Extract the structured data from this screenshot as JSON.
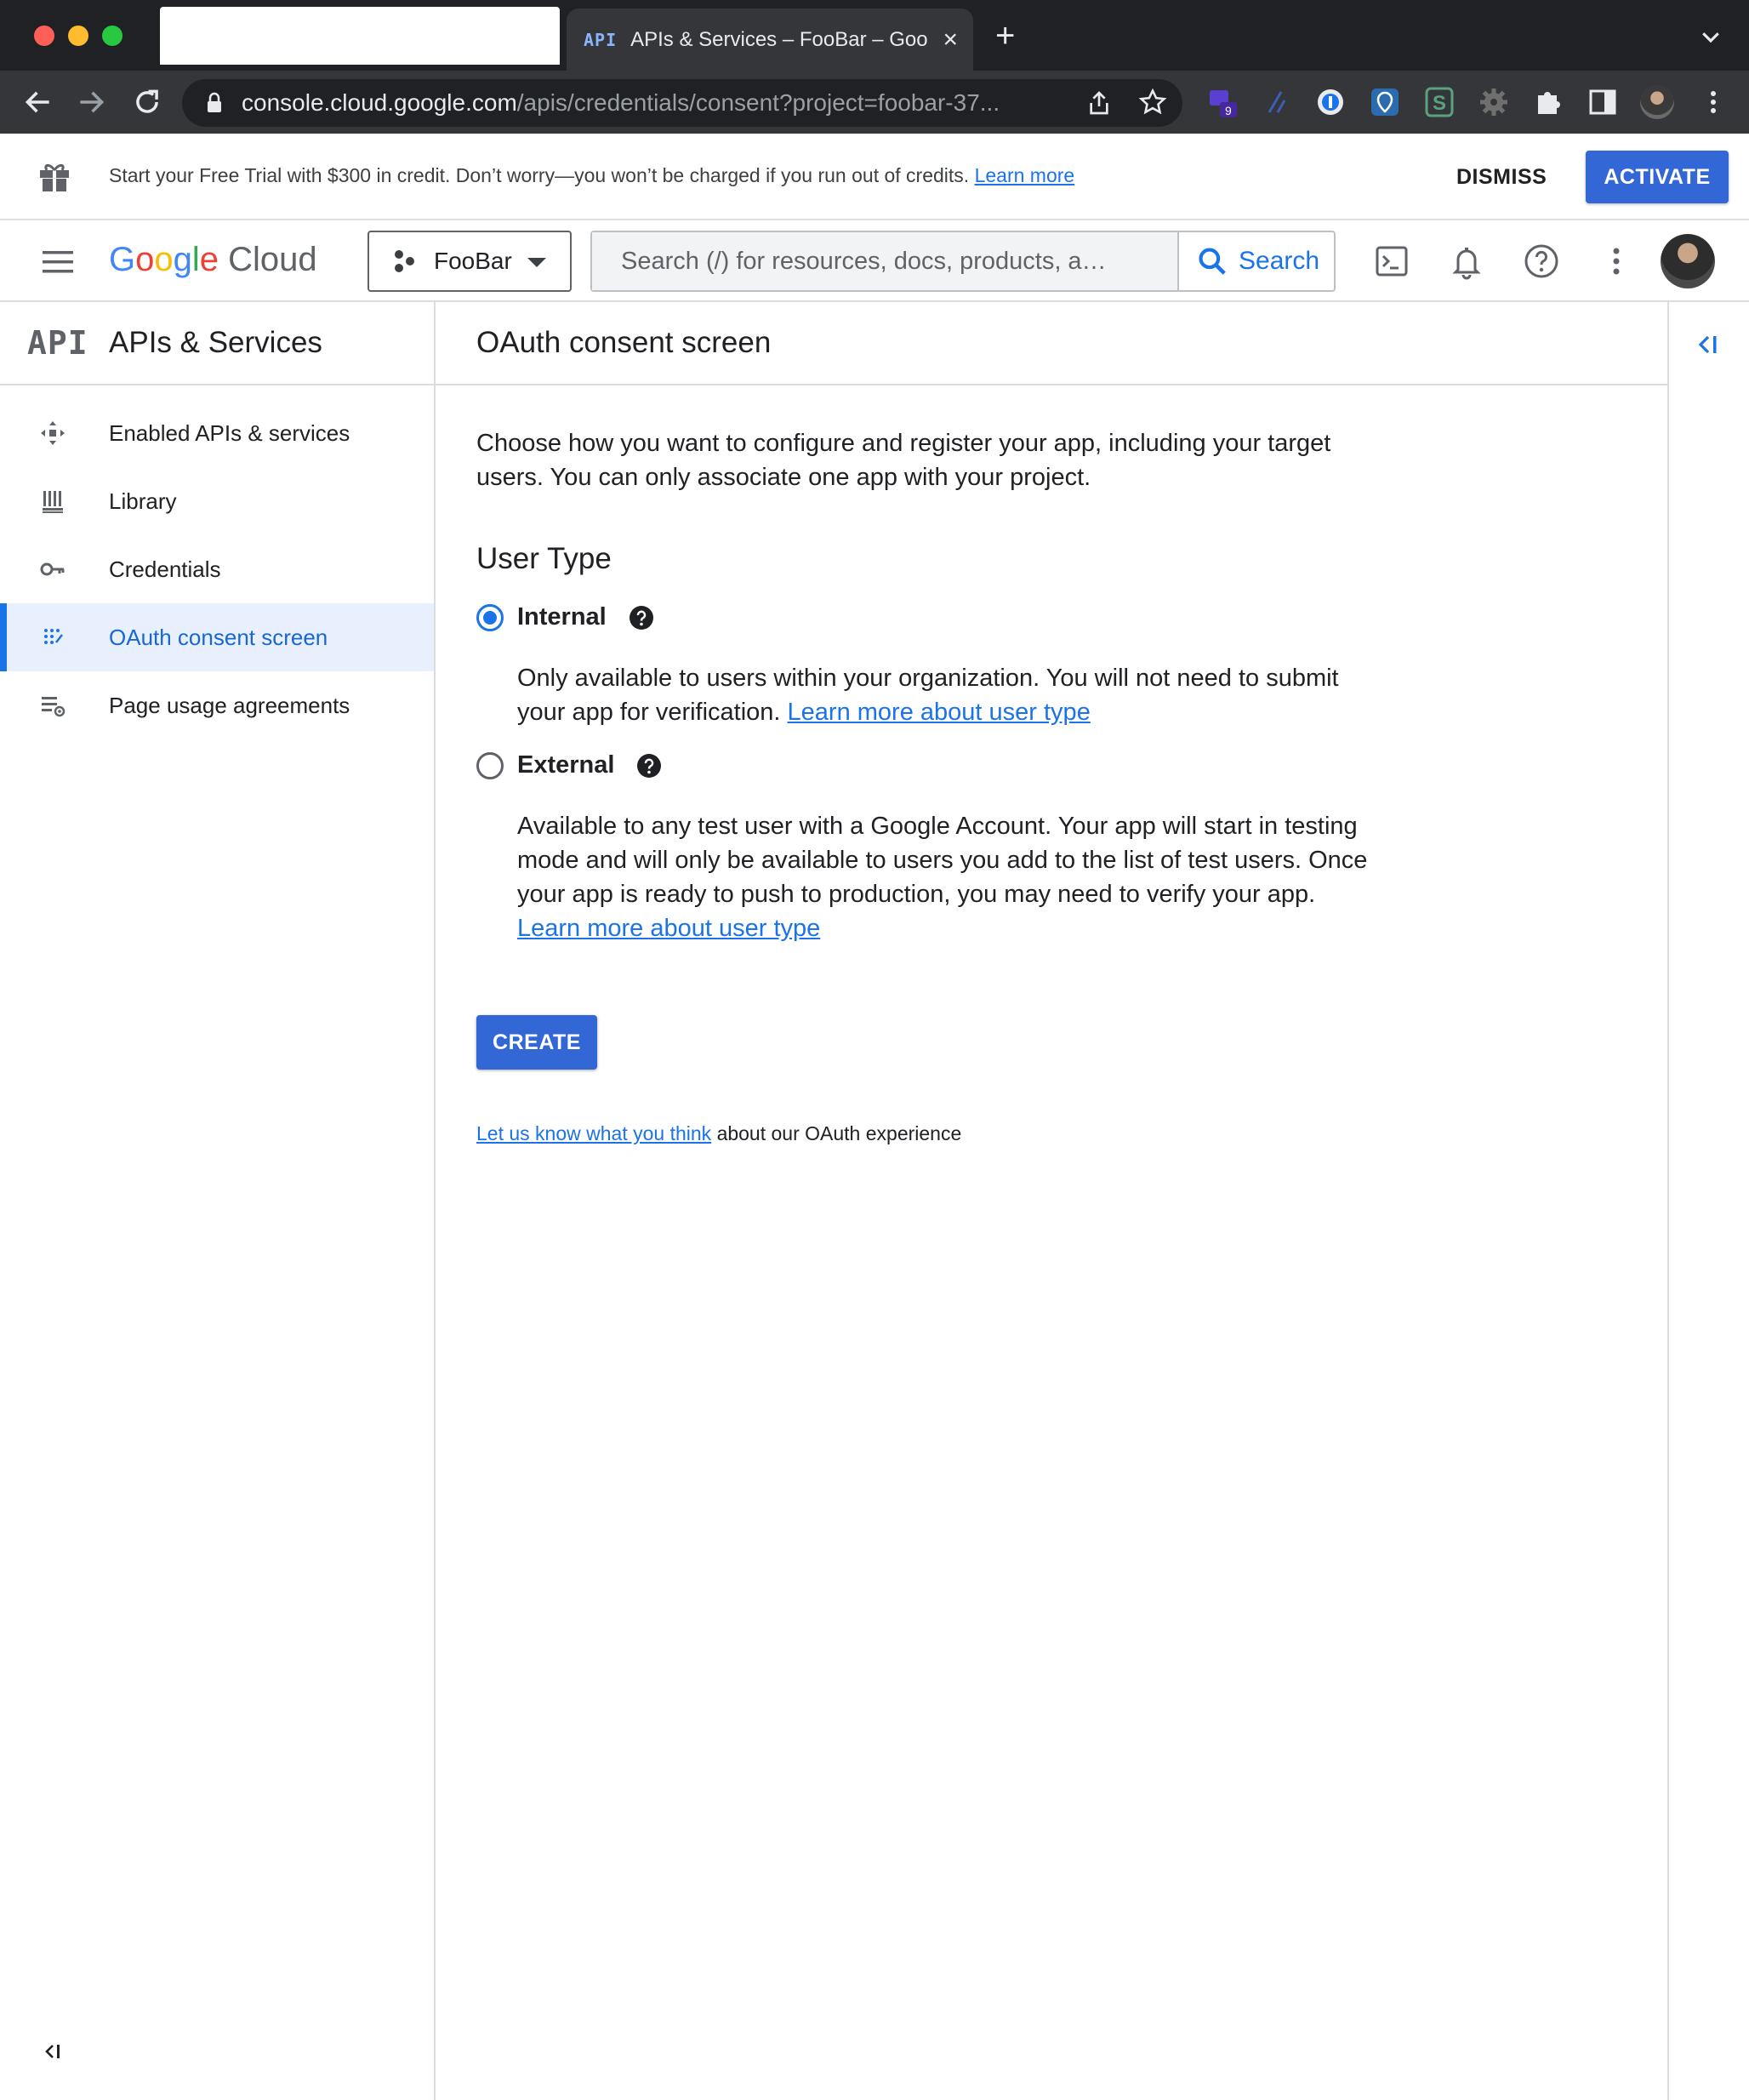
{
  "browser": {
    "tab": {
      "api_label": "API",
      "title": "APIs & Services – FooBar – Goo",
      "close": "×"
    },
    "new_tab": "+",
    "url_host": "console.cloud.google.com",
    "url_path": "/apis/credentials/consent?project=foobar-37...",
    "extension_badge": "9"
  },
  "banner": {
    "message": "Start your Free Trial with $300 in credit. Don’t worry—you won’t be charged if you run out of credits.",
    "learn_more": "Learn more",
    "dismiss": "DISMISS",
    "activate": "ACTIVATE"
  },
  "header": {
    "logo_google": [
      "G",
      "o",
      "o",
      "g",
      "l",
      "e"
    ],
    "logo_cloud": "Cloud",
    "project_name": "FooBar",
    "search_placeholder": "Search (/) for resources, docs, products, a…",
    "search_button": "Search"
  },
  "sidebar": {
    "api_logo": "API",
    "title": "APIs & Services",
    "items": [
      {
        "label": "Enabled APIs & services",
        "icon": "enabled-apis-icon"
      },
      {
        "label": "Library",
        "icon": "library-icon"
      },
      {
        "label": "Credentials",
        "icon": "key-icon"
      },
      {
        "label": "OAuth consent screen",
        "icon": "oauth-consent-icon",
        "active": true
      },
      {
        "label": "Page usage agreements",
        "icon": "page-usage-icon"
      }
    ]
  },
  "main": {
    "title": "OAuth consent screen",
    "intro": "Choose how you want to configure and register your app, including your target users. You can only associate one app with your project.",
    "user_type_heading": "User Type",
    "options": [
      {
        "label": "Internal",
        "selected": true,
        "description": "Only available to users within your organization. You will not need to submit your app for verification.",
        "link": "Learn more about user type"
      },
      {
        "label": "External",
        "selected": false,
        "description": "Available to any test user with a Google Account. Your app will start in testing mode and will only be available to users you add to the list of test users. Once your app is ready to push to production, you may need to verify your app.",
        "link": "Learn more about user type"
      }
    ],
    "create_button": "CREATE",
    "feedback_link": "Let us know what you think",
    "feedback_suffix": "about our OAuth experience"
  },
  "colors": {
    "primary": "#1a73e8",
    "button": "#3367d6",
    "chrome_dark": "#202124",
    "chrome_toolbar": "#35363a",
    "active_nav_bg": "#e8f0fe"
  }
}
